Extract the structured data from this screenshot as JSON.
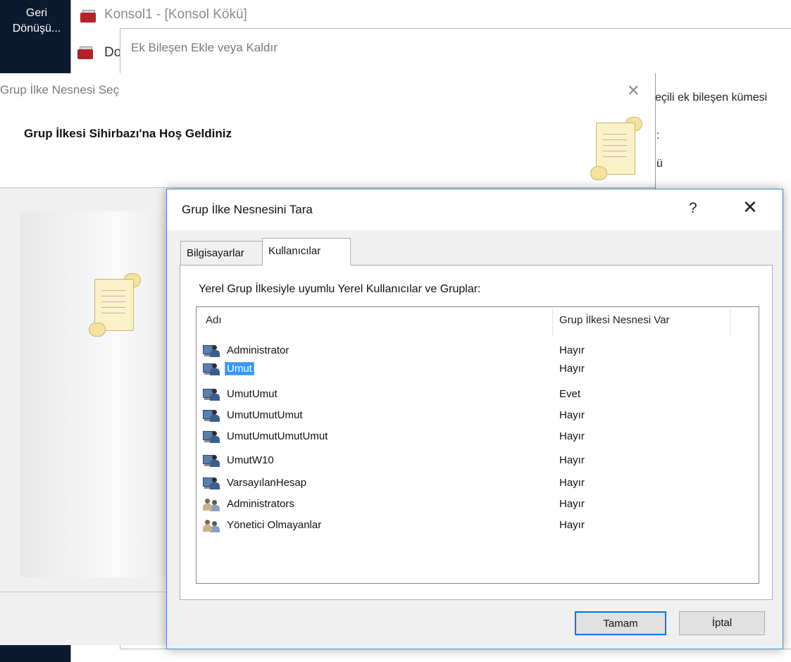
{
  "desktop": {
    "label": "Geri Dönüşü..."
  },
  "console_window": {
    "title": "Konsol1 - [Konsol Kökü]",
    "menu_partial": "Do"
  },
  "add_snapin_window": {
    "title": "Ek Bileşen Ekle veya Kaldır",
    "right_text": "eçili ek bileşen kümesi",
    "right_text_partial": "ü",
    "right_text_colon": ":"
  },
  "gpo_wizard": {
    "title": "Grup İlke Nesnesi Seç",
    "welcome": "Grup İlkesi Sihirbazı'na Hoş Geldiniz",
    "close_glyph": "✕"
  },
  "browse_dialog": {
    "title": "Grup İlke Nesnesini Tara",
    "help_glyph": "?",
    "close_glyph": "✕",
    "tabs": [
      {
        "label": "Bilgisayarlar",
        "active": false
      },
      {
        "label": "Kullanıcılar",
        "active": true
      }
    ],
    "panel_label": "Yerel Grup İlkesiyle uyumlu Yerel Kullanıcılar ve Gruplar:",
    "columns": {
      "name": "Adı",
      "has_gpo": "Grup İlkesi Nesnesi Var"
    },
    "rows": [
      {
        "name": "Administrator",
        "has_gpo": "Hayır",
        "icon": "user-icon",
        "selected": false
      },
      {
        "name": "Umut",
        "has_gpo": "Hayır",
        "icon": "user-icon",
        "selected": true
      },
      {
        "name": "UmutUmut",
        "has_gpo": "Evet",
        "icon": "user-icon",
        "selected": false
      },
      {
        "name": "UmutUmutUmut",
        "has_gpo": "Hayır",
        "icon": "user-icon",
        "selected": false
      },
      {
        "name": "UmutUmutUmutUmut",
        "has_gpo": "Hayır",
        "icon": "user-icon",
        "selected": false
      },
      {
        "name": "UmutW10",
        "has_gpo": "Hayır",
        "icon": "user-icon",
        "selected": false
      },
      {
        "name": "VarsayılanHesap",
        "has_gpo": "Hayır",
        "icon": "user-icon",
        "selected": false
      },
      {
        "name": "Administrators",
        "has_gpo": "Hayır",
        "icon": "group-icon",
        "selected": false
      },
      {
        "name": "Yönetici Olmayanlar",
        "has_gpo": "Hayır",
        "icon": "group-icon",
        "selected": false
      }
    ],
    "buttons": {
      "ok": "Tamam",
      "cancel": "İptal"
    },
    "accent_color": "#0078d7",
    "selection_color": "#3399ff"
  }
}
